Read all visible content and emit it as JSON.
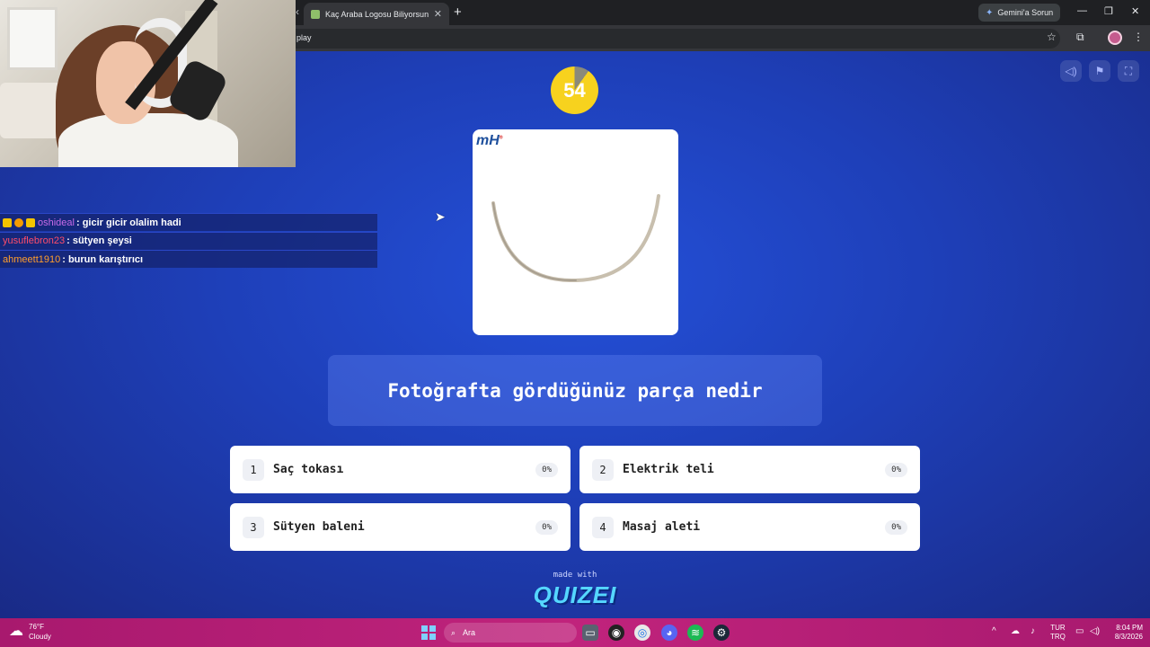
{
  "browser": {
    "tab_title": "Kaç Araba Logosu Biliyorsun? (",
    "tab_close": "✕",
    "new_tab": "+",
    "gemini_label": "Gemini'a Sorun",
    "address_text": "play",
    "window_controls": [
      "—",
      "❐",
      "✕"
    ]
  },
  "quiz": {
    "timer": "54",
    "brand_text": "mH",
    "question": "Fotoğrafta gördüğünüz parça nedir",
    "answers": [
      {
        "num": "1",
        "label": "Saç tokası",
        "pct": "0%"
      },
      {
        "num": "2",
        "label": "Elektrik teli",
        "pct": "0%"
      },
      {
        "num": "3",
        "label": "Sütyen baleni",
        "pct": "0%"
      },
      {
        "num": "4",
        "label": "Masaj aleti",
        "pct": "0%"
      }
    ],
    "made_with": "made with",
    "logo": "QUIZEI"
  },
  "chat": [
    {
      "user": "oshideal",
      "user_color": "#c86be8",
      "message": ": gicir gicir olalim hadi"
    },
    {
      "user": "yusuflebron23",
      "user_color": "#ff4d6a",
      "message": ": sütyen şeysi"
    },
    {
      "user": "ahmeett1910",
      "user_color": "#ff9e2c",
      "message": ": burun karıştırıcı"
    }
  ],
  "taskbar": {
    "temperature": "76°F",
    "weather": "Cloudy",
    "search_placeholder": "Ara",
    "lang_top": "TUR",
    "lang_bottom": "TRQ",
    "time": "8:04 PM",
    "date": "8/3/2026"
  },
  "colors": {
    "page_blue": "#1e3fb8",
    "timer_yellow": "#f7d21e",
    "taskbar_magenta": "#b81f77"
  }
}
